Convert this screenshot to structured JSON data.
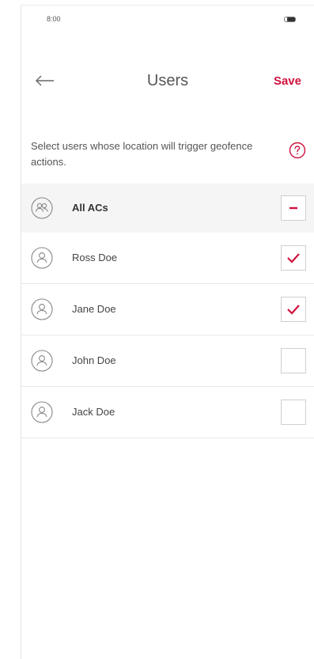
{
  "status_bar": {
    "time": "8:00",
    "battery_icon": "battery-icon"
  },
  "header": {
    "back_icon": "arrow-left-icon",
    "title": "Users",
    "save_label": "Save"
  },
  "description": {
    "text": "Select users whose location will trigger geofence actions.",
    "help_icon": "question-circle-icon"
  },
  "select_all": {
    "label": "All ACs",
    "icon": "user-group-icon",
    "state": "indeterminate"
  },
  "users": [
    {
      "name": "Ross Doe",
      "icon": "user-icon",
      "checked": true
    },
    {
      "name": "Jane Doe",
      "icon": "user-icon",
      "checked": true
    },
    {
      "name": "John Doe",
      "icon": "user-icon",
      "checked": false
    },
    {
      "name": "Jack Doe",
      "icon": "user-icon",
      "checked": false
    }
  ],
  "colors": {
    "accent": "#d0123e",
    "text": "#555555",
    "divider": "#e8e8e8",
    "highlight_row": "#f5f5f6"
  }
}
